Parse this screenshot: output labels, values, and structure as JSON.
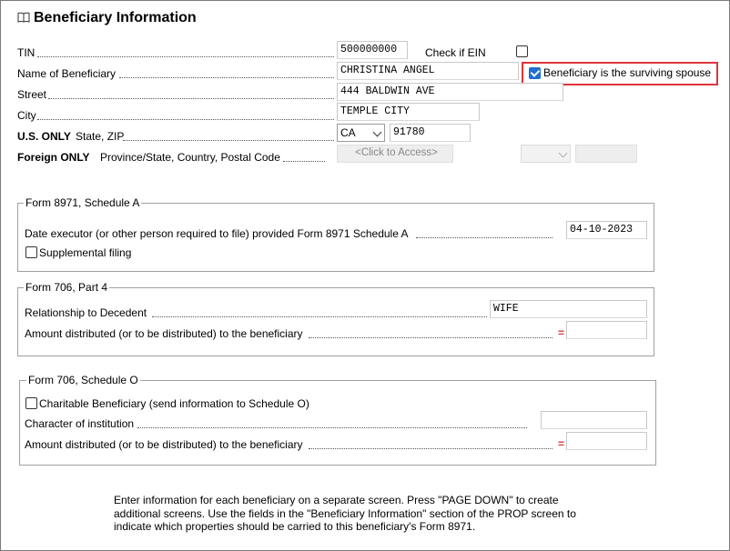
{
  "header": {
    "title": "Beneficiary Information",
    "icon": "book-icon"
  },
  "fields": {
    "tin": {
      "label": "TIN",
      "value": "500000000"
    },
    "check_ein": {
      "label": "Check if EIN",
      "checked": false
    },
    "name": {
      "label": "Name of Beneficiary",
      "value": "CHRISTINA ANGEL"
    },
    "surviving_spouse": {
      "label": "Beneficiary is the surviving spouse",
      "checked": true
    },
    "street": {
      "label": "Street",
      "value": "444 BALDWIN AVE"
    },
    "city": {
      "label": "City",
      "value": "TEMPLE CITY"
    },
    "us_only": {
      "label_bold": "U.S. ONLY",
      "label": "State, ZIP",
      "state": "CA",
      "zip": "91780"
    },
    "foreign": {
      "label_bold": "Foreign ONLY",
      "label": "Province/State, Country, Postal Code",
      "placeholder": "<Click to Access>"
    }
  },
  "form8971": {
    "title": "Form 8971, Schedule A",
    "date_label": "Date executor (or other person required to file) provided Form 8971 Schedule A",
    "date_value": "04-10-2023",
    "supplemental_label": "Supplemental filing",
    "supplemental_checked": false
  },
  "form706_part4": {
    "title": "Form 706, Part 4",
    "relationship_label": "Relationship to Decedent",
    "relationship_value": "WIFE",
    "amount_label": "Amount distributed (or to be distributed) to the beneficiary",
    "amount_marker": "=",
    "amount_value": ""
  },
  "form706_scheduleO": {
    "title": "Form 706, Schedule O",
    "charitable_label": "Charitable Beneficiary (send information to Schedule O)",
    "charitable_checked": false,
    "character_label": "Character of institution",
    "character_value": "",
    "amount_label": "Amount distributed (or to be distributed) to the beneficiary",
    "amount_marker": "=",
    "amount_value": ""
  },
  "note": "Enter information for each beneficiary on a separate screen.  Press \"PAGE DOWN\" to create additional screens.  Use the fields in the \"Beneficiary Information\" section of the PROP screen to indicate which properties should be carried to this beneficiary's Form 8971.",
  "colors": {
    "highlight": "#e0343a",
    "checkbox": "#1f6fd0",
    "marker": "#e0343a"
  }
}
